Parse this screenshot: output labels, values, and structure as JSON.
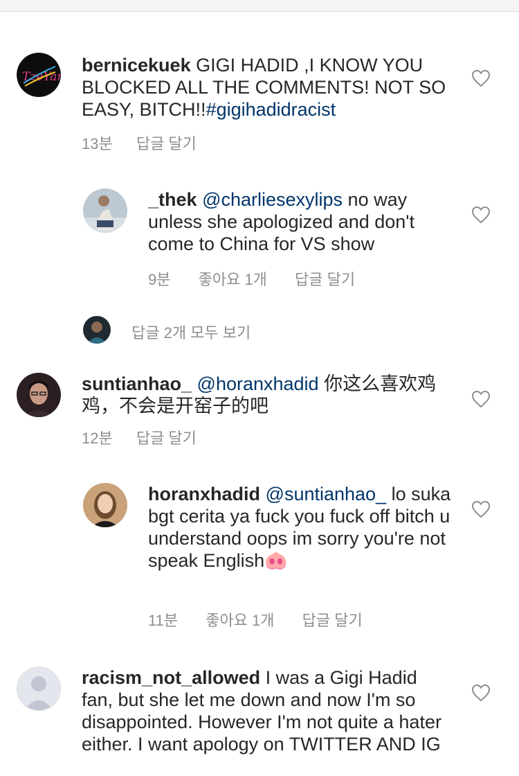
{
  "comments": [
    {
      "username": "bernicekuek",
      "text": " GIGI HADID ,I KNOW YOU BLOCKED ALL THE COMMENTS! NOT SO EASY, BITCH!!",
      "hashtag": "#gigihadidracist",
      "time": "13분",
      "reply_label": "답글 달기",
      "avatar_text": "TzeYan",
      "icon": "heart-outline-icon"
    },
    {
      "username": "_thek",
      "mention": "@charliesexylips",
      "text": " no way unless she apologized and don't come to China for VS show",
      "time": "9분",
      "likes": "좋아요 1개",
      "reply_label": "답글 달기",
      "icon": "heart-outline-icon"
    },
    {
      "username": "suntianhao_",
      "mention": "@horanxhadid",
      "text": " 你这么喜欢鸡鸡，不会是开窑子的吧",
      "time": "12분",
      "reply_label": "답글 달기",
      "icon": "heart-outline-icon"
    },
    {
      "username": "horanxhadid",
      "mention": "@suntianhao_",
      "text": " lo suka bgt cerita ya fuck you fuck off bitch u understand oops im sorry you're not speak English",
      "emoji": "🐽",
      "time": "11분",
      "likes": "좋아요 1개",
      "reply_label": "답글 달기",
      "icon": "heart-outline-icon"
    },
    {
      "username": "racism_not_allowed",
      "text": " I was a Gigi Hadid fan, but she let me down and now I'm so disappointed. However I'm not quite a hater either. I want apology on TWITTER AND IG",
      "icon": "heart-outline-icon"
    }
  ],
  "view_replies": "답글 2개 모두 보기",
  "colors": {
    "text": "#262626",
    "meta": "#8e8e8e",
    "mention": "#003569"
  }
}
